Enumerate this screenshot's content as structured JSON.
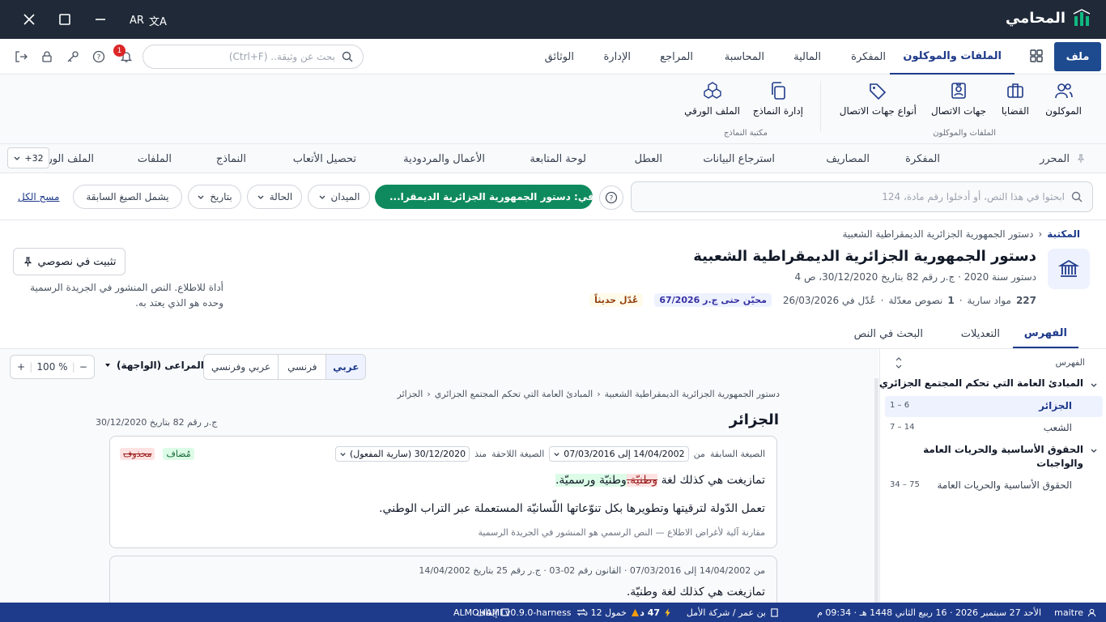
{
  "titlebar": {
    "brand": "المحامي",
    "lang": "AR"
  },
  "menubar": {
    "file": "ملف",
    "items": [
      "الملفات والموكلون",
      "المفكرة",
      "المالية",
      "المحاسبة",
      "المراجع",
      "الإدارة",
      "الوثائق"
    ],
    "search_placeholder": "بحث عن وثيقة.. (Ctrl+F)",
    "notifications_count": "1"
  },
  "ribbon": {
    "group1": {
      "label": "الملفات والموكلون",
      "items": [
        "الموكلون",
        "القضايا",
        "جهات الاتصال",
        "أنواع جهات الاتصال"
      ]
    },
    "group2": {
      "label": "مكتبة النماذج",
      "items": [
        "إدارة النماذج",
        "الملف الورقي"
      ]
    }
  },
  "tabs": {
    "items": [
      "المحرر",
      "المفكرة",
      "المصاريف",
      "استرجاع البيانات",
      "العطل",
      "لوحة المتابعة",
      "الأعمال والمردودية",
      "تحصيل الأتعاب",
      "النماذج",
      "الملفات",
      "الملف الور"
    ],
    "more": "+32"
  },
  "filters": {
    "search_placeholder": "ابحثوا في هذا النص، أو أدخلوا رقم مادة، 124",
    "active_chip": "في: دستور الجمهورية الجزائرية الديمقرا...",
    "chips": [
      "الميدان",
      "الحالة",
      "بتاريخ",
      "يشمل الصيغ السابقة"
    ],
    "clear_all": "مسح الكل"
  },
  "document": {
    "breadcrumb_root": "المكتبة",
    "breadcrumb_current": "دستور الجمهورية الجزائرية الديمقراطية الشعبية",
    "title": "دستور الجمهورية الجزائرية الديمقراطية الشعبية",
    "meta": "دستور سنة 2020  ·  ج.ر رقم 82 بتاريخ 30/12/2020، ص 4",
    "stat_articles_num": "227",
    "stat_articles_label": "مواد سارية",
    "stat_amended_num": "1",
    "stat_amended_label": "نصوص معدّلة",
    "stat_date": "عُدّل في 26/03/2026",
    "badge_updated": "محيّن حتى ج.ر 67/2026",
    "badge_recent": "عُدّل حديثاً",
    "pin_button": "تثبيت في نصوصي",
    "disclaimer": "أداة للاطلاع. النص المنشور في الجريدة الرسمية وحده هو الذي يعتد به."
  },
  "doc_tabs": [
    "الفهرس",
    "التعديلات",
    "البحث في النص"
  ],
  "toc": {
    "header": "الفهرس",
    "sections": [
      {
        "title": "المبادئ العامة التي تحكم المجتمع الجزائري",
        "items": [
          {
            "label": "الجزائر",
            "range": "1 – 6",
            "active": true
          },
          {
            "label": "الشعب",
            "range": "7 – 14",
            "active": false
          }
        ]
      },
      {
        "title": "الحقوق الأساسية والحريات العامة والواجبات",
        "items": [
          {
            "label": "الحقوق الأساسية والحريات العامة",
            "range": "34 – 75",
            "active": false
          }
        ]
      }
    ]
  },
  "viewer": {
    "zoom": "100 %",
    "mirror_select": "المراعى (الواجهة)",
    "langs": [
      "عربي",
      "فرنسي",
      "عربي وفرنسي"
    ],
    "active_lang": "عربي",
    "crumbs": [
      "دستور الجمهورية الجزائرية الديمقراطية الشعبية",
      "المبادئ العامة التي تحكم المجتمع الجزائري",
      "الجزائر"
    ],
    "article_title": "الجزائر",
    "article_ref": "ج.ر رقم 82 بتاريخ 30/12/2020",
    "card1": {
      "prev_label": "الصيغة السابقة",
      "prev_from": "من",
      "prev_value": "14/04/2002 إلى 07/03/2016",
      "next_label": "الصيغة اللاحقة",
      "next_from": "منذ",
      "next_value": "30/12/2020 (سارية المفعول)",
      "tag_added": "مُضاف",
      "tag_deleted": "محذوف",
      "p1_start": "تمازيغت هي كذلك لغة ",
      "p1_deleted": "وطنيّة.",
      "p1_inserted": "وطنيّة ورسميّة.",
      "p2": "تعمل الدّولة لترقيتها وتطويرها بكل تنوّعاتها اللّسانيّة المستعملة عبر التراب الوطني.",
      "note": "مقارنة آلية لأغراض الاطلاع — النص الرسمي هو المنشور في الجريدة الرسمية"
    },
    "card2": {
      "meta": "من 14/04/2002 إلى 07/03/2016 · القانون رقم 02-03 · ج.ر رقم 25 بتاريخ 14/04/2002",
      "p1": "تمازيغت هي كذلك لغة وطنيّة."
    }
  },
  "statusbar": {
    "user": "maitre",
    "date": "الأحد 27 سبتمبر 2026 · 16 ربيع الثاني 1448 هـ · 09:34 م",
    "firm": "بن عمر / شركة الأمل",
    "clock": "47 د",
    "dormant": "خمول 12 د",
    "pause": "إيقاف",
    "version": "ALMOHAMI v0.9.0-harness"
  },
  "colors": {
    "primary": "#1e3a8a",
    "green": "#0f8a5f",
    "titlebar": "#1f2937"
  }
}
